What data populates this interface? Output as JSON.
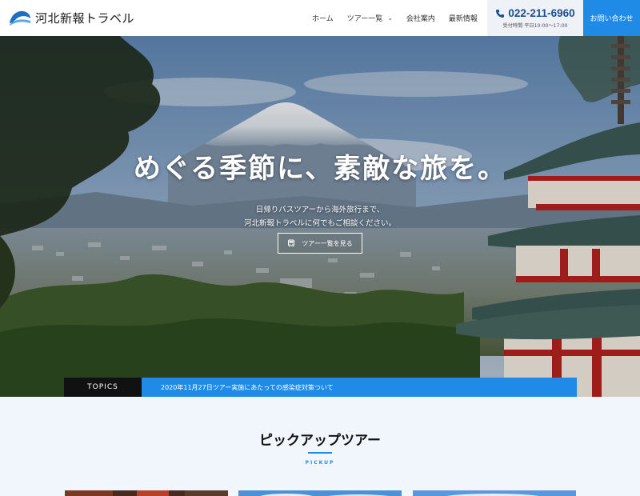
{
  "header": {
    "logo_text": "河北新報トラベル",
    "nav": [
      {
        "label": "ホーム"
      },
      {
        "label": "ツアー一覧",
        "has_dropdown": true
      },
      {
        "label": "会社案内"
      },
      {
        "label": "最新情報"
      }
    ],
    "phone": "022-211-6960",
    "phone_hours": "受付時間 平日10:00〜17:00",
    "contact_label": "お問い合わせ"
  },
  "hero": {
    "title": "めぐる季節に、素敵な旅を。",
    "subtitle_line1": "日帰りバスツアーから海外旅行まで、",
    "subtitle_line2": "河北新報トラベルに何でもご相談ください。",
    "button_label": "ツアー一覧を見る"
  },
  "topics": {
    "label": "TOPICS",
    "text": "2020年11月27日ツアー実施にあたっての感染症対策ついて"
  },
  "pickup": {
    "title": "ピックアップツアー",
    "subtitle": "PICKUP"
  },
  "colors": {
    "accent": "#1f8be6",
    "phone": "#1a4f8f",
    "topics_label_bg": "#111111",
    "pickup_bg": "#f0f6fc"
  },
  "icons": {
    "logo": "wave-logo-icon",
    "phone": "phone-icon",
    "dropdown": "chevron-down-icon",
    "button": "bus-icon"
  }
}
